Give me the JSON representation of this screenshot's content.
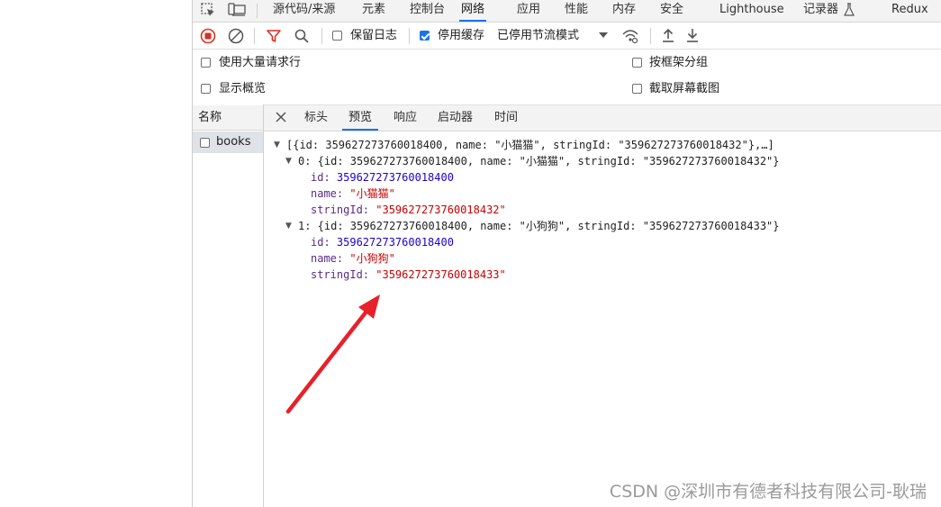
{
  "top_tabs": {
    "sources": "源代码/来源",
    "elements": "元素",
    "console": "控制台",
    "network": "网络",
    "application": "应用",
    "performance": "性能",
    "memory": "内存",
    "security": "安全",
    "lighthouse": "Lighthouse",
    "recorder": "记录器",
    "redux": "Redux"
  },
  "toolbar": {
    "preserve_log": "保留日志",
    "disable_cache": "停用缓存",
    "throttling": "已停用节流模式"
  },
  "options": {
    "large_rows": "使用大量请求行",
    "group_by_frame": "按框架分组",
    "show_overview": "显示概览",
    "capture_screenshots": "截取屏幕截图"
  },
  "request_list": {
    "header": "名称",
    "rows": [
      {
        "name": "books"
      }
    ]
  },
  "detail_tabs": {
    "headers": "标头",
    "preview": "预览",
    "response": "响应",
    "initiator": "启动器",
    "timing": "时间"
  },
  "preview": {
    "summary": "[{id: 359627273760018400, name: \"小猫猫\", stringId: \"359627273760018432\"},…]",
    "items": [
      {
        "summary": "0: {id: 359627273760018400, name: \"小猫猫\", stringId: \"359627273760018432\"}",
        "id": "359627273760018400",
        "name": "\"小猫猫\"",
        "stringId": "\"359627273760018432\""
      },
      {
        "summary": "1: {id: 359627273760018400, name: \"小狗狗\", stringId: \"359627273760018433\"}",
        "id": "359627273760018400",
        "name": "\"小狗狗\"",
        "stringId": "\"359627273760018433\""
      }
    ],
    "labels": {
      "id": "id: ",
      "name": "name: ",
      "stringId": "stringId: "
    }
  },
  "watermark": "CSDN @深圳市有德者科技有限公司-耿瑞",
  "colors": {
    "accent": "#1a73e8",
    "record_red": "#d93025",
    "arrow_red": "#e8202a"
  }
}
